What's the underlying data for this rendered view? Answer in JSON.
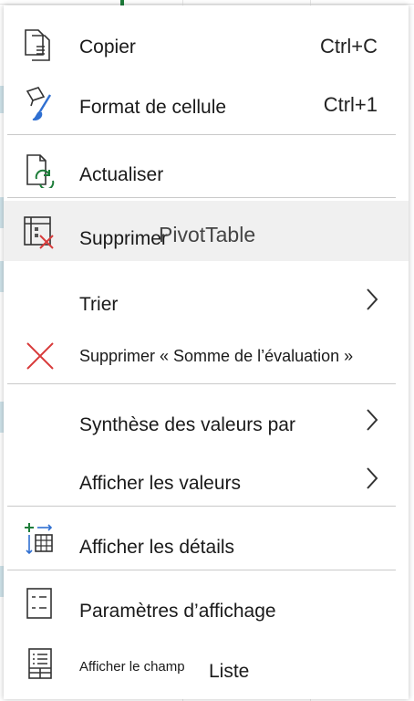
{
  "menu": {
    "copy": {
      "label": "Copier",
      "shortcut": "Ctrl+C"
    },
    "format": {
      "label": "Format de cellule",
      "shortcut": "Ctrl+1"
    },
    "refresh": {
      "label": "Actualiser"
    },
    "delete_pivot": {
      "label": "Supprimer",
      "overlay": "PivotTable"
    },
    "sort": {
      "label": "Trier"
    },
    "remove_field": {
      "label": "Supprimer « Somme de l’évaluation »"
    },
    "summarize": {
      "label": "Synthèse des valeurs par"
    },
    "show_values": {
      "label": "Afficher les valeurs"
    },
    "show_details": {
      "label": "Afficher les détails"
    },
    "display_settings": {
      "label": "Paramètres d’affichage"
    },
    "field_list": {
      "label": "Afficher le champ",
      "overlay": "Liste"
    }
  },
  "colors": {
    "accent_green": "#1e7d3a",
    "delete_red": "#d83b3b",
    "hover_bg": "#f0f0f0",
    "separator": "#c9c9c9"
  }
}
